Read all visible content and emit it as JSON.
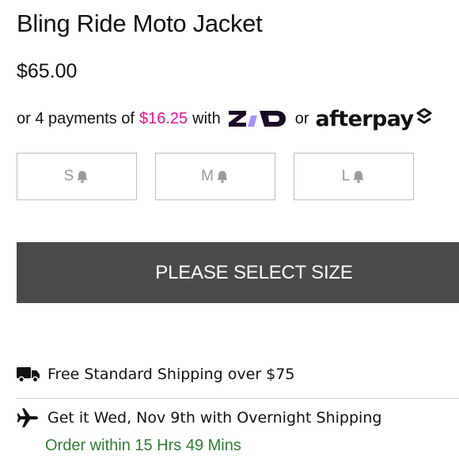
{
  "product": {
    "title": "Bling Ride Moto Jacket",
    "price": "$65.00"
  },
  "installments": {
    "prefix": "or 4 payments of",
    "amount": "$16.25",
    "with_text": "with",
    "zip_logo": "zip",
    "or_text": "or",
    "afterpay_logo": "afterpay",
    "amount_color": "#e5128c",
    "zip_color": "#1a0826",
    "zip_accent": "#aa8fff"
  },
  "sizes": [
    {
      "label": "S",
      "icon": "bell-icon"
    },
    {
      "label": "M",
      "icon": "bell-icon"
    },
    {
      "label": "L",
      "icon": "bell-icon"
    }
  ],
  "cta": {
    "label": "PLEASE SELECT SIZE",
    "background": "#4a4a4a"
  },
  "shipping": {
    "free_text": "Free Standard Shipping over $75",
    "free_icon": "truck-icon",
    "overnight_text": "Get it Wed, Nov 9th with Overnight Shipping",
    "overnight_icon": "airplane-icon",
    "deadline_text": "Order within 15 Hrs 49 Mins",
    "deadline_color": "#2e7d32"
  }
}
